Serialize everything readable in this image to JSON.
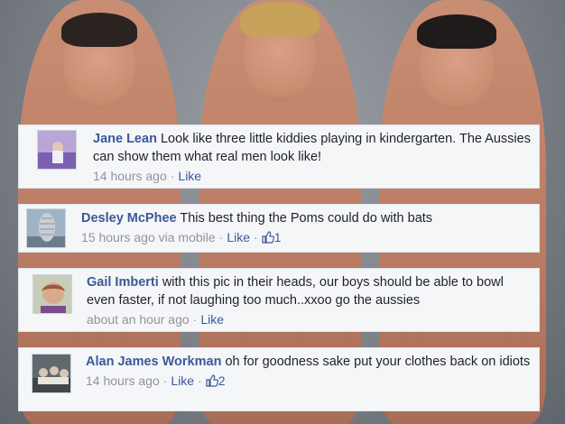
{
  "comments": [
    {
      "name": "Jane Lean",
      "body": "Look like three little kiddies playing in kindergarten. The Aussies can show them what real men look like!",
      "time": "14 hours ago",
      "via": "",
      "like": "Like",
      "likes": ""
    },
    {
      "name": "Desley McPhee",
      "body": "This best thing the Poms could do with bats",
      "time": "15 hours ago via mobile",
      "like": "Like",
      "likes": "1"
    },
    {
      "name": "Gail Imberti",
      "body": "with this pic in their heads, our boys should be able to bowl even faster, if not laughing too much..xxoo go the aussies",
      "time": "about an hour ago",
      "like": "Like",
      "likes": ""
    },
    {
      "name": "Alan James Workman",
      "body": "oh for goodness sake put your clothes back on idiots",
      "time": "14 hours ago",
      "like": "Like",
      "likes": "2"
    }
  ],
  "icons": {
    "separator": "·",
    "thumb": "thumbs-up-icon"
  },
  "colors": {
    "name_link": "#3b5998",
    "meta": "#90949c",
    "panel": "#f5f6f8"
  }
}
